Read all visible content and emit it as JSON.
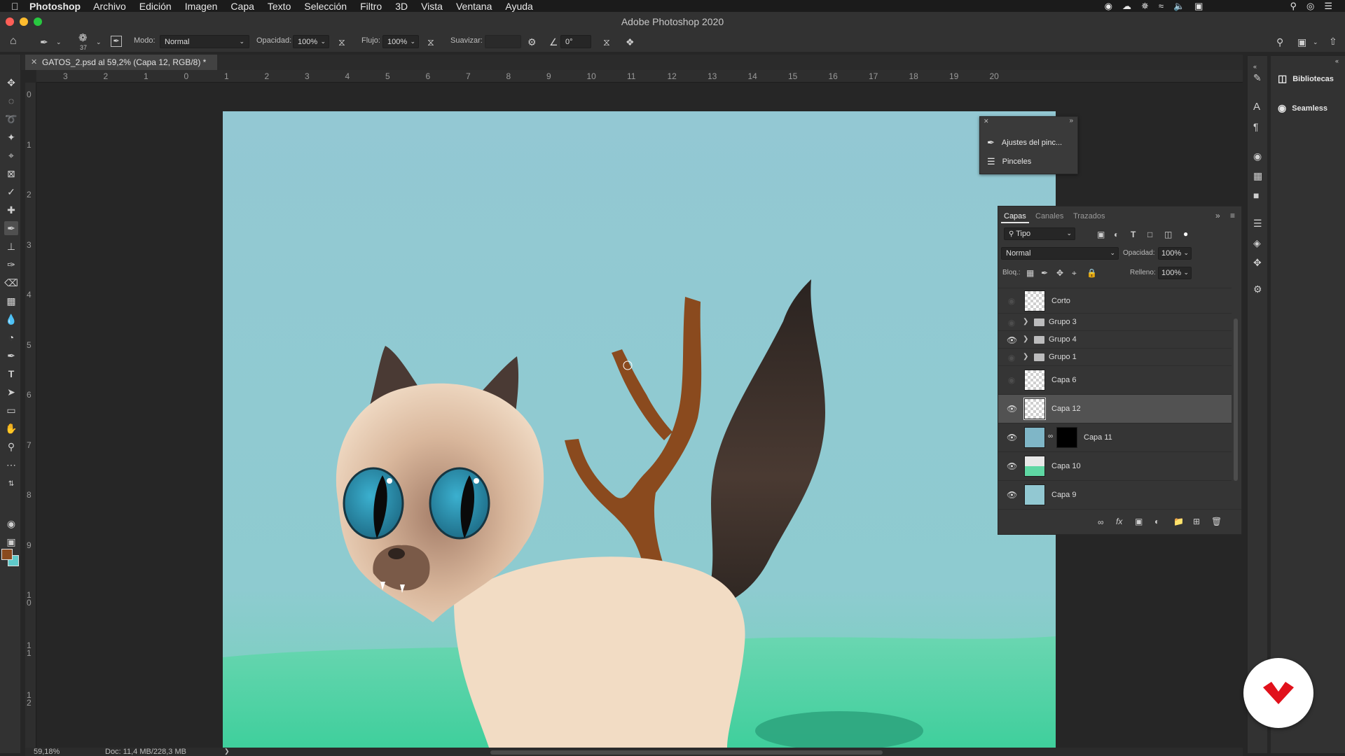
{
  "menubar": {
    "app": "Photoshop",
    "items": [
      "Archivo",
      "Edición",
      "Imagen",
      "Capa",
      "Texto",
      "Selección",
      "Filtro",
      "3D",
      "Vista",
      "Ventana",
      "Ayuda"
    ]
  },
  "titlebar": {
    "title": "Adobe Photoshop 2020"
  },
  "options": {
    "brush_size": "37",
    "mode_label": "Modo:",
    "mode_value": "Normal",
    "opacity_label": "Opacidad:",
    "opacity_value": "100%",
    "flow_label": "Flujo:",
    "flow_value": "100%",
    "smoothing_label": "Suavizar:",
    "smoothing_value": "",
    "angle_value": "0°"
  },
  "document": {
    "tab_label": "GATOS_2.psd al 59,2% (Capa 12, RGB/8) *"
  },
  "rulers": {
    "h_ticks": [
      "3",
      "2",
      "1",
      "0",
      "1",
      "2",
      "3",
      "4",
      "5",
      "6",
      "7",
      "8",
      "9",
      "10",
      "11",
      "12",
      "13",
      "14",
      "15",
      "16",
      "17",
      "18",
      "19",
      "20"
    ],
    "v_ticks": [
      "0",
      "1",
      "2",
      "3",
      "4",
      "5",
      "6",
      "7",
      "8",
      "9",
      "10",
      "11",
      "12"
    ]
  },
  "status": {
    "zoom": "59,18%",
    "doc_info": "Doc: 11,4 MB/228,3 MB"
  },
  "brush_panel": {
    "items": [
      {
        "label": "Ajustes del pinc...",
        "icon": "brush-settings-icon"
      },
      {
        "label": "Pinceles",
        "icon": "brushes-icon"
      }
    ]
  },
  "layers_panel": {
    "tabs": [
      "Capas",
      "Canales",
      "Trazados"
    ],
    "filter_value": "Tipo",
    "blend_mode": "Normal",
    "opacity_label": "Opacidad:",
    "opacity_value": "100%",
    "lock_label": "Bloq.:",
    "fill_label": "Relleno:",
    "fill_value": "100%",
    "layers": [
      {
        "name": "Corto",
        "type": "layer",
        "visible": false,
        "selected": false
      },
      {
        "name": "Grupo 3",
        "type": "group",
        "visible": false,
        "selected": false
      },
      {
        "name": "Grupo 4",
        "type": "group",
        "visible": true,
        "selected": false
      },
      {
        "name": "Grupo 1",
        "type": "group",
        "visible": false,
        "selected": false
      },
      {
        "name": "Capa 6",
        "type": "layer",
        "visible": false,
        "selected": false
      },
      {
        "name": "Capa 12",
        "type": "layer",
        "visible": true,
        "selected": true
      },
      {
        "name": "Capa 11",
        "type": "masked",
        "visible": true,
        "selected": false
      },
      {
        "name": "Capa 10",
        "type": "layer",
        "visible": true,
        "selected": false
      },
      {
        "name": "Capa 9",
        "type": "layer",
        "visible": true,
        "selected": false
      }
    ]
  },
  "dock": {
    "panels": [
      {
        "label": "Bibliotecas",
        "icon": "libraries-icon"
      },
      {
        "label": "Seamless",
        "icon": "seamless-icon"
      }
    ]
  },
  "colors": {
    "foreground": "#8a4a1e",
    "background": "#5fc9c9",
    "sky": "#93c8d3",
    "grass": "#4fd3a6",
    "accent_red": "#e1111b"
  }
}
